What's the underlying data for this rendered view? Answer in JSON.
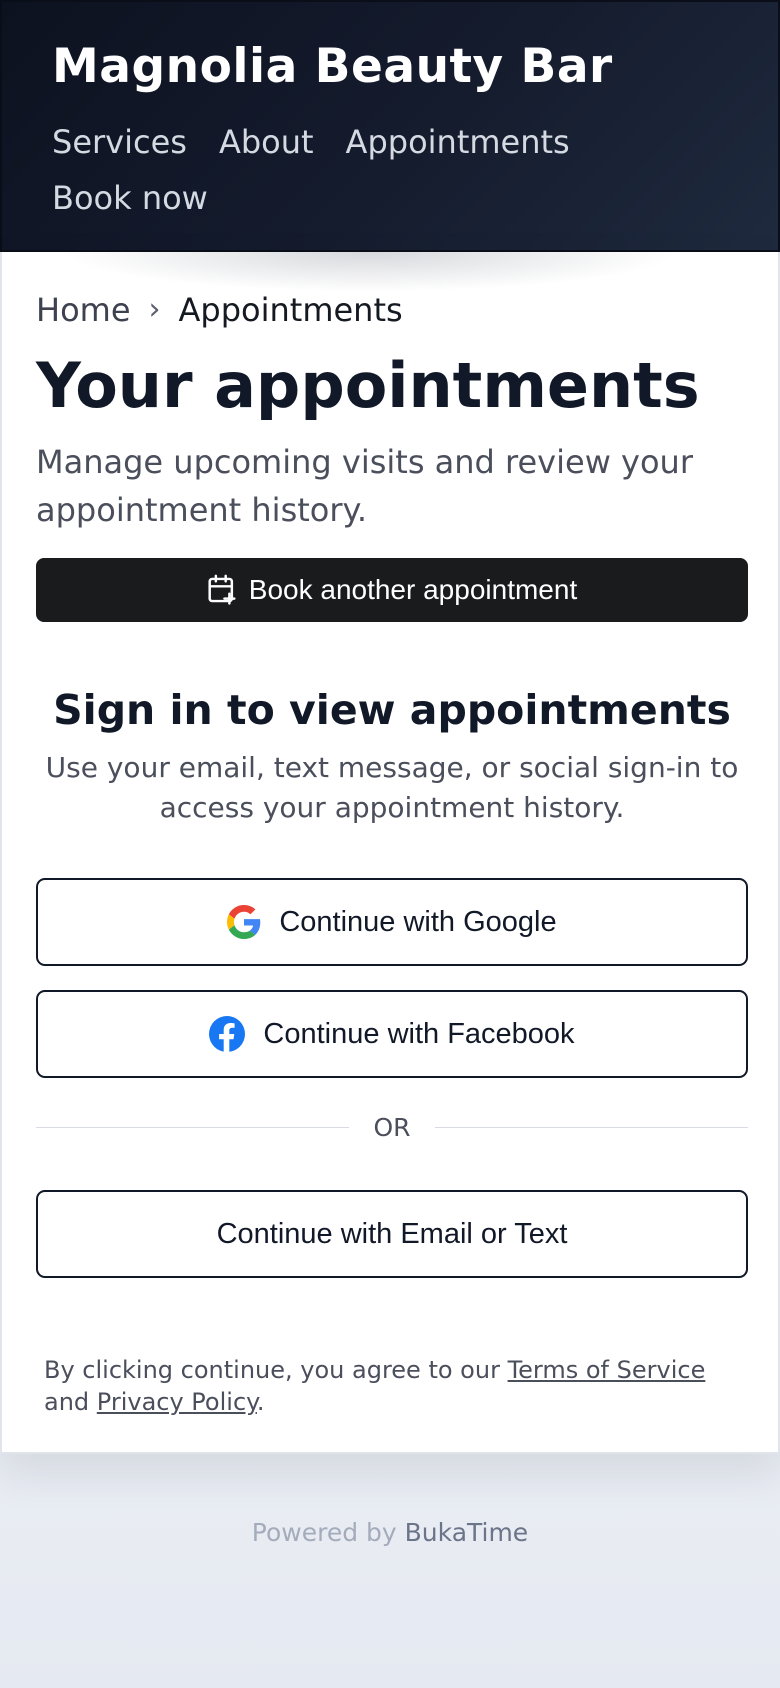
{
  "header": {
    "brand": "Magnolia Beauty Bar",
    "nav": [
      "Services",
      "About",
      "Appointments",
      "Book now"
    ]
  },
  "breadcrumb": {
    "home": "Home",
    "separator": "›",
    "current": "Appointments"
  },
  "main": {
    "title": "Your appointments",
    "subtitle": "Manage upcoming visits and review your appointment history.",
    "book_button": "Book another appointment",
    "book_icon": "calendar-plus-icon"
  },
  "signin": {
    "title": "Sign in to view appointments",
    "description": "Use your email, text message, or social sign-in to access your appointment history.",
    "google_button": "Continue with Google",
    "facebook_button": "Continue with Facebook",
    "divider_text": "OR",
    "email_button": "Continue with Email or Text",
    "google_icon": "google-icon",
    "facebook_icon": "facebook-icon"
  },
  "legal": {
    "prefix": "By clicking continue, you agree to our ",
    "terms": "Terms of Service",
    "middle": " and ",
    "privacy": "Privacy Policy",
    "suffix": "."
  },
  "footer": {
    "powered_prefix": "Powered by ",
    "powered_brand": "BukaTime"
  },
  "colors": {
    "header_bg": "#151c2e",
    "primary_button": "#1a1b1d",
    "facebook_blue": "#1877f2",
    "google_blue": "#4285f4",
    "google_red": "#ea4335",
    "google_yellow": "#fbbc05",
    "google_green": "#34a853"
  }
}
